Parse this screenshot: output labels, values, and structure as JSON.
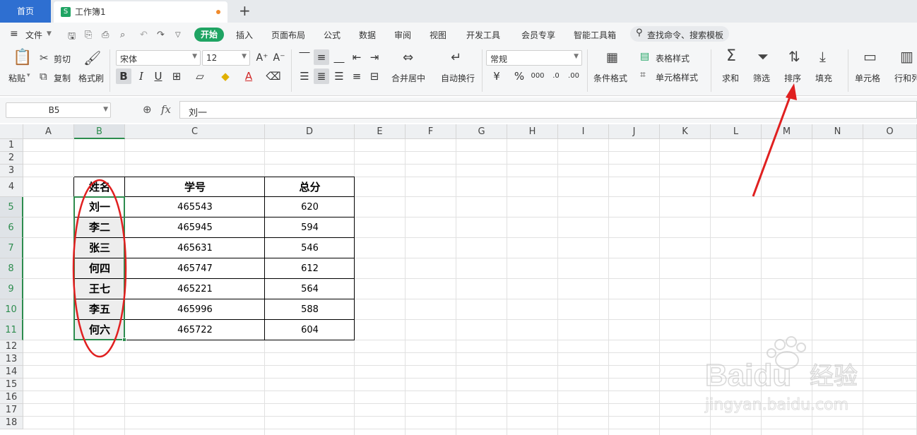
{
  "tabs": {
    "home": "首页",
    "document": "工作簿1"
  },
  "menu": {
    "file": "文件",
    "items": [
      "开始",
      "插入",
      "页面布局",
      "公式",
      "数据",
      "审阅",
      "视图",
      "开发工具",
      "会员专享",
      "智能工具箱"
    ],
    "search_placeholder": "查找命令、搜索模板"
  },
  "ribbon": {
    "paste": "粘贴",
    "cut": "剪切",
    "copy": "复制",
    "format_painter": "格式刷",
    "font_name": "宋体",
    "font_size": "12",
    "merge_center": "合并居中",
    "wrap_text": "自动换行",
    "number_format": "常规",
    "conditional_format": "条件格式",
    "table_style": "表格样式",
    "cell_style": "单元格样式",
    "sum": "求和",
    "filter": "筛选",
    "sort": "排序",
    "fill": "填充",
    "cell": "单元格",
    "row_col": "行和列"
  },
  "formula_bar": {
    "cell_ref": "B5",
    "fx": "fx",
    "content": "刘一"
  },
  "columns": [
    "A",
    "B",
    "C",
    "D",
    "E",
    "F",
    "G",
    "H",
    "I",
    "J",
    "K",
    "L",
    "M",
    "N",
    "O"
  ],
  "rows": [
    "1",
    "2",
    "3",
    "4",
    "5",
    "6",
    "7",
    "8",
    "9",
    "10",
    "11",
    "12",
    "13",
    "14",
    "15",
    "16",
    "17",
    "18"
  ],
  "table": {
    "headers": [
      "姓名",
      "学号",
      "总分"
    ],
    "rows": [
      [
        "刘一",
        "465543",
        "620"
      ],
      [
        "李二",
        "465945",
        "594"
      ],
      [
        "张三",
        "465631",
        "546"
      ],
      [
        "何四",
        "465747",
        "612"
      ],
      [
        "王七",
        "465221",
        "564"
      ],
      [
        "李五",
        "465996",
        "588"
      ],
      [
        "何六",
        "465722",
        "604"
      ]
    ]
  },
  "colors": {
    "accent": "#1fa463",
    "selection": "#2d8c4e",
    "home_tab": "#2e6fd1",
    "annotation": "#e02020"
  },
  "watermark": {
    "brand": "Baidu",
    "cn": "经验",
    "url": "jingyan.baidu.com"
  }
}
